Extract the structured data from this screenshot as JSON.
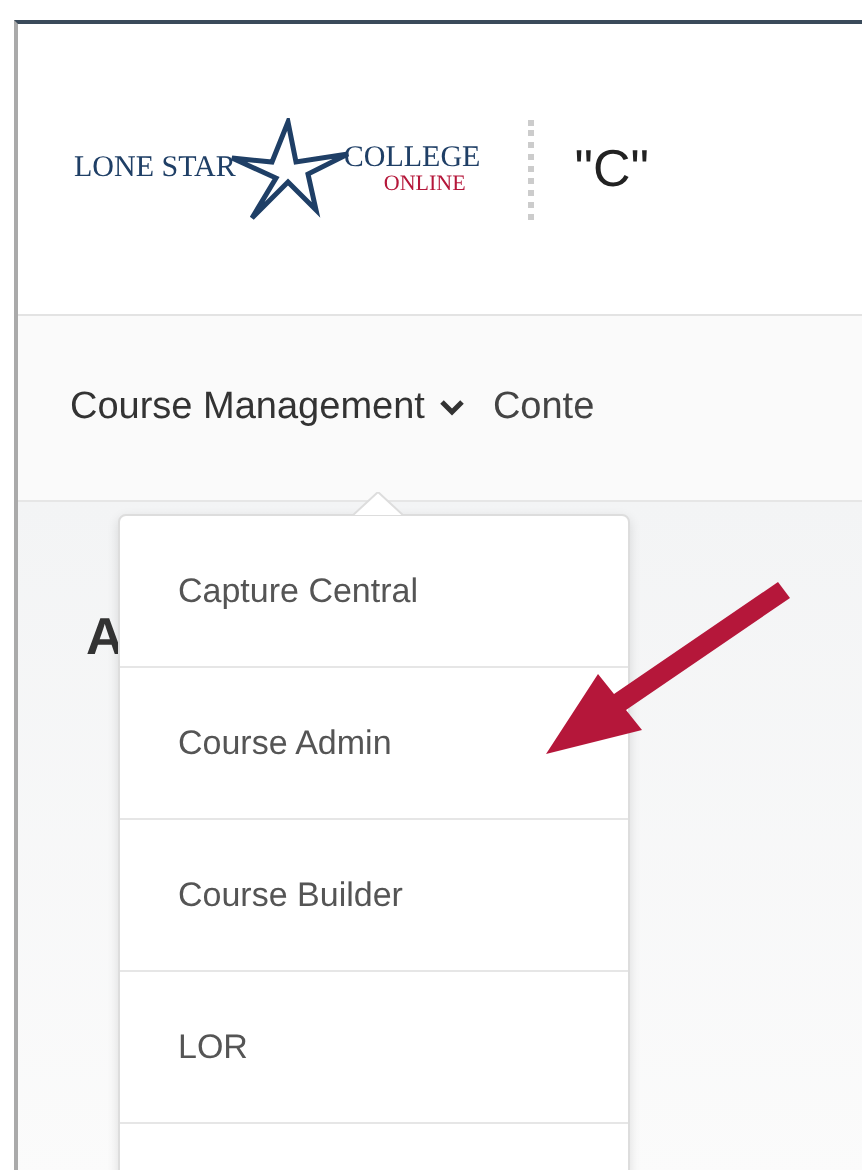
{
  "header": {
    "logo": {
      "left": "LONE STAR",
      "right": "COLLEGE",
      "sub": "ONLINE"
    },
    "course_title": "\"C\""
  },
  "nav": {
    "items": [
      {
        "label": "Course Management",
        "expanded": true
      },
      {
        "label": "Conte",
        "expanded": false
      }
    ]
  },
  "page_heading": "A",
  "dropdown": {
    "items": [
      {
        "label": "Capture Central"
      },
      {
        "label": "Course Admin"
      },
      {
        "label": "Course Builder"
      },
      {
        "label": "LOR"
      }
    ]
  },
  "annotation": {
    "kind": "arrow",
    "color": "#b5173a"
  }
}
